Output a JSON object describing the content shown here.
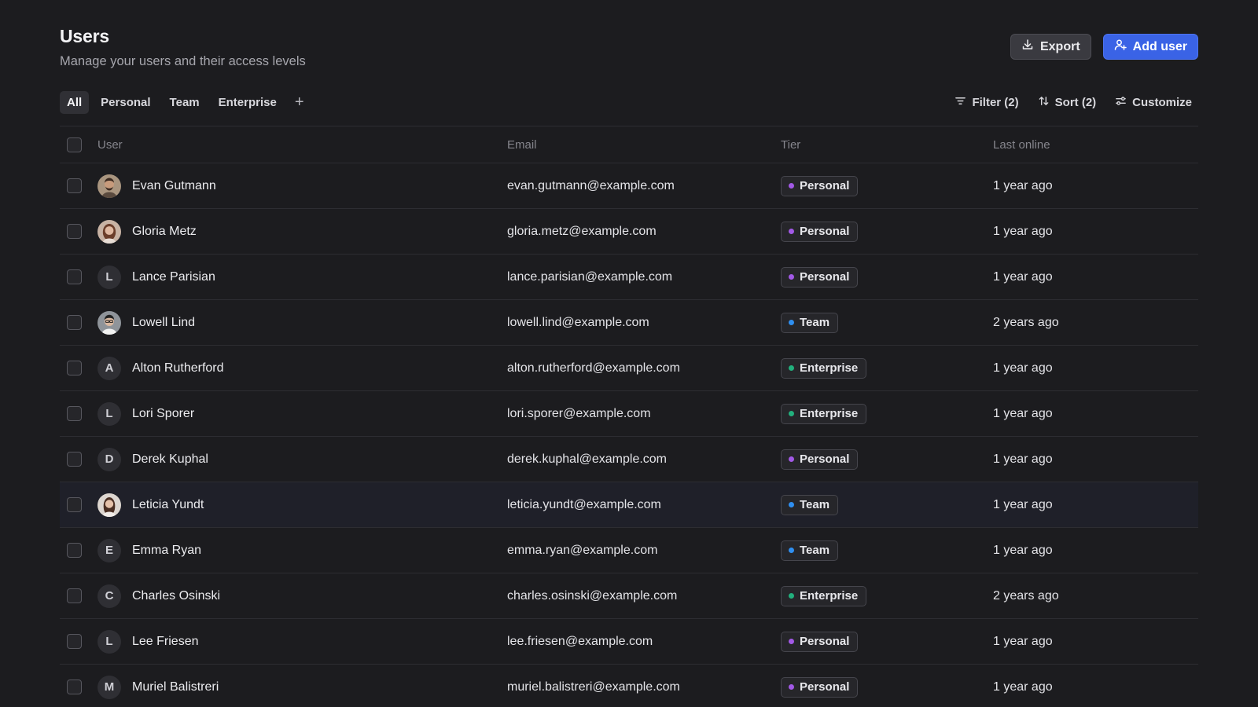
{
  "header": {
    "title": "Users",
    "subtitle": "Manage your users and their access levels"
  },
  "actions": {
    "export_label": "Export",
    "add_user_label": "Add user"
  },
  "tabs": [
    {
      "label": "All",
      "active": true
    },
    {
      "label": "Personal",
      "active": false
    },
    {
      "label": "Team",
      "active": false
    },
    {
      "label": "Enterprise",
      "active": false
    }
  ],
  "toolbar": {
    "filter_label": "Filter (2)",
    "sort_label": "Sort (2)",
    "customize_label": "Customize"
  },
  "table": {
    "columns": {
      "user": "User",
      "email": "Email",
      "tier": "Tier",
      "last_online": "Last online"
    },
    "rows": [
      {
        "name": "Evan Gutmann",
        "avatar": "photo",
        "initial": "",
        "email": "evan.gutmann@example.com",
        "tier": "Personal",
        "last_online": "1 year ago"
      },
      {
        "name": "Gloria Metz",
        "avatar": "photo",
        "initial": "",
        "email": "gloria.metz@example.com",
        "tier": "Personal",
        "last_online": "1 year ago"
      },
      {
        "name": "Lance Parisian",
        "avatar": "initial",
        "initial": "L",
        "email": "lance.parisian@example.com",
        "tier": "Personal",
        "last_online": "1 year ago"
      },
      {
        "name": "Lowell Lind",
        "avatar": "photo",
        "initial": "",
        "email": "lowell.lind@example.com",
        "tier": "Team",
        "last_online": "2 years ago"
      },
      {
        "name": "Alton Rutherford",
        "avatar": "initial",
        "initial": "A",
        "email": "alton.rutherford@example.com",
        "tier": "Enterprise",
        "last_online": "1 year ago"
      },
      {
        "name": "Lori Sporer",
        "avatar": "initial",
        "initial": "L",
        "email": "lori.sporer@example.com",
        "tier": "Enterprise",
        "last_online": "1 year ago"
      },
      {
        "name": "Derek Kuphal",
        "avatar": "initial",
        "initial": "D",
        "email": "derek.kuphal@example.com",
        "tier": "Personal",
        "last_online": "1 year ago"
      },
      {
        "name": "Leticia Yundt",
        "avatar": "photo",
        "initial": "",
        "email": "leticia.yundt@example.com",
        "tier": "Team",
        "last_online": "1 year ago",
        "highlighted": true
      },
      {
        "name": "Emma Ryan",
        "avatar": "initial",
        "initial": "E",
        "email": "emma.ryan@example.com",
        "tier": "Team",
        "last_online": "1 year ago"
      },
      {
        "name": "Charles Osinski",
        "avatar": "initial",
        "initial": "C",
        "email": "charles.osinski@example.com",
        "tier": "Enterprise",
        "last_online": "2 years ago"
      },
      {
        "name": "Lee Friesen",
        "avatar": "initial",
        "initial": "L",
        "email": "lee.friesen@example.com",
        "tier": "Personal",
        "last_online": "1 year ago"
      },
      {
        "name": "Muriel Balistreri",
        "avatar": "initial",
        "initial": "M",
        "email": "muriel.balistreri@example.com",
        "tier": "Personal",
        "last_online": "1 year ago"
      }
    ]
  },
  "tier_colors": {
    "Personal": "#a259e6",
    "Team": "#2f8ff0",
    "Enterprise": "#22b07d"
  },
  "colors": {
    "background": "#1c1c1f",
    "accent": "#3a63e6"
  }
}
